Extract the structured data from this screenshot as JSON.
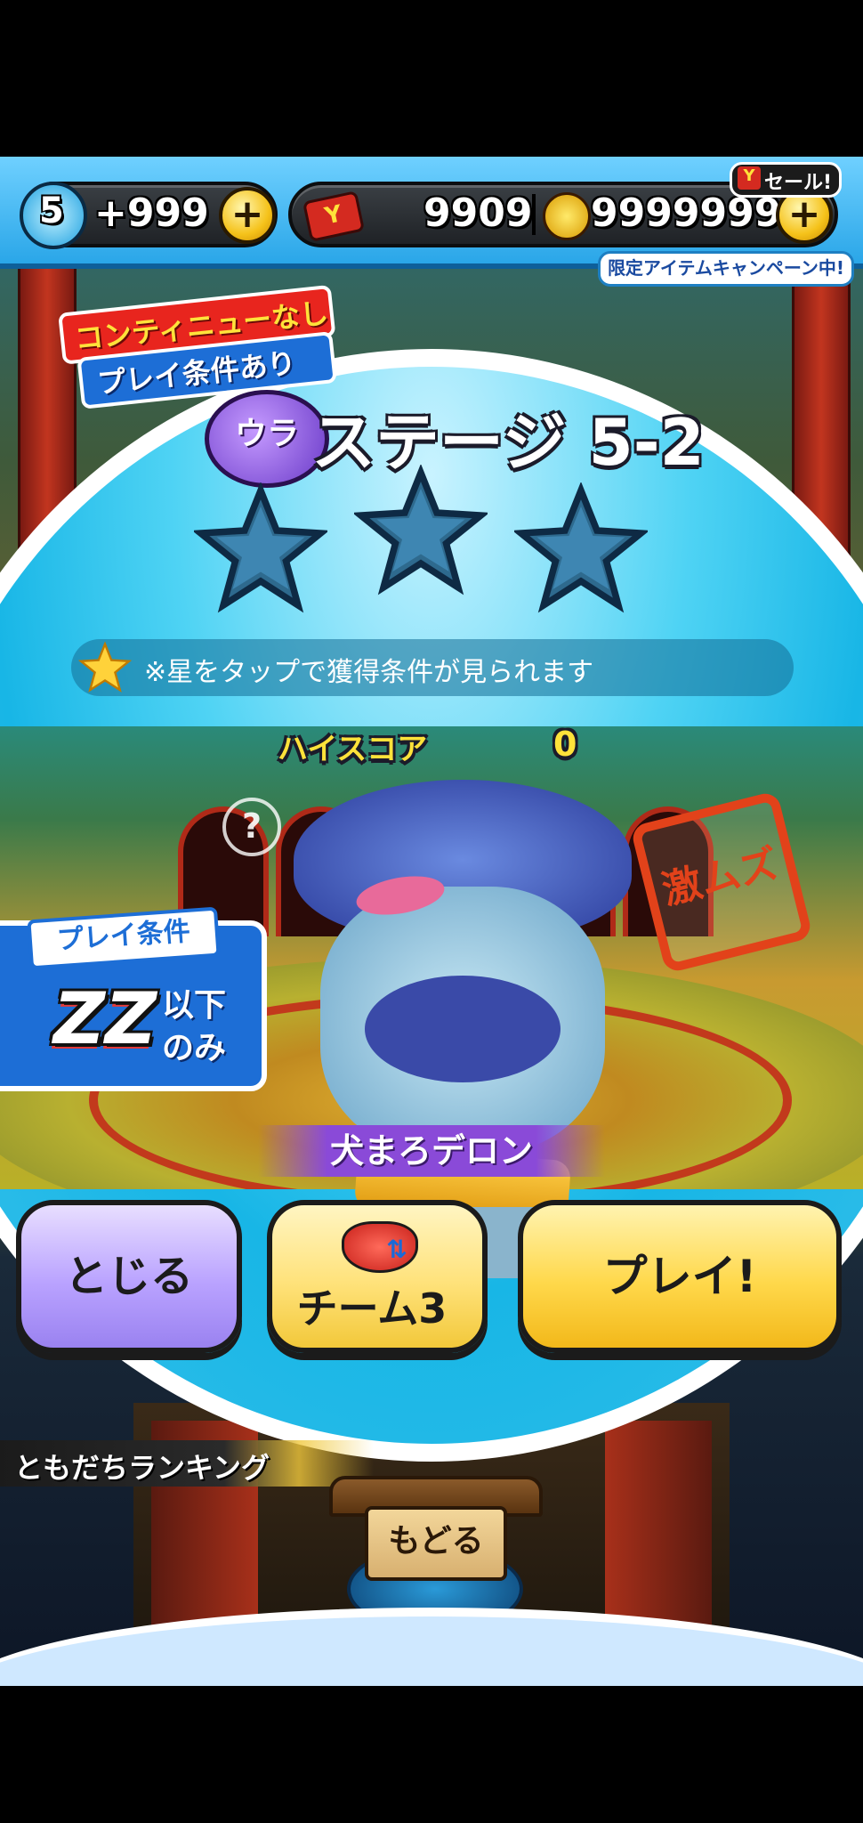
{
  "top_bar": {
    "watch_level": "5",
    "spirit_count": "+999",
    "gacha_ticket_count": "9909",
    "money_count": "9999999",
    "sale_badge": "セール!",
    "campaign_banner": "限定アイテムキャンペーン中!"
  },
  "stage": {
    "condition_badge_line1": "コンティニューなし",
    "condition_badge_line2": "プレイ条件あり",
    "ura_label": "ウラ",
    "title": "ステージ 5-2",
    "stars_hint": "※星をタップで獲得条件が見られます",
    "highscore_label": "ハイスコア",
    "highscore_value": "0",
    "difficulty_stamp": "激ムズ",
    "play_condition_title": "プレイ条件",
    "play_condition_rank": "ZZ",
    "play_condition_suffix_line1": "以下",
    "play_condition_suffix_line2": "のみ",
    "boss_name": "犬まろデロン",
    "help_icon_label": "?"
  },
  "buttons": {
    "close": "とじる",
    "team": "チーム3",
    "play": "プレイ!",
    "back": "もどる"
  },
  "ranking": {
    "label": "ともだちランキング"
  },
  "colors": {
    "close_button": "#c9b6ff",
    "team_button": "#ffe27a",
    "play_button": "#ffd84a",
    "accent_blue": "#2aa6e8",
    "stamp_red": "#e2421a"
  }
}
